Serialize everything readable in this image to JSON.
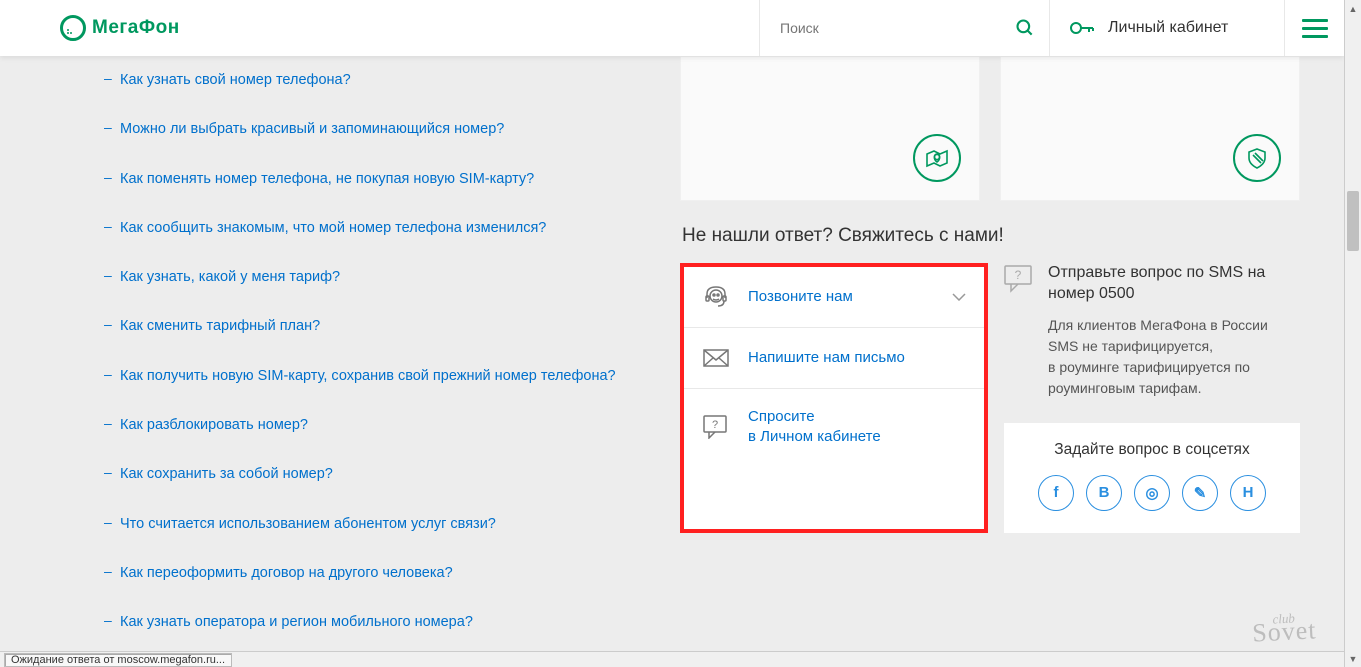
{
  "header": {
    "logo_text": "МегаФон",
    "search_placeholder": "Поиск",
    "cabinet_label": "Личный кабинет"
  },
  "faq": [
    "Как узнать свой номер телефона?",
    "Можно ли выбрать красивый и запоминающийся номер?",
    "Как поменять номер телефона, не покупая новую SIM-карту?",
    "Как сообщить знакомым, что мой номер телефона изменился?",
    "Как узнать, какой у меня тариф?",
    "Как сменить тарифный план?",
    "Как получить новую SIM-карту, сохранив свой прежний номер телефона?",
    "Как разблокировать номер?",
    "Как сохранить за собой номер?",
    "Что считается использованием абонентом услуг связи?",
    "Как переоформить договор на другого человека?",
    "Как узнать оператора и регион мобильного номера?"
  ],
  "contact_heading": "Не нашли ответ? Свяжитесь с нами!",
  "contact_items": {
    "call": "Позвоните нам",
    "write": "Напишите нам\nписьмо",
    "ask_line1": "Спросите",
    "ask_line2": "в Личном кабинете"
  },
  "sms": {
    "title": "Отправьте вопрос по SMS на номер 0500",
    "desc": "Для клиентов МегаФона в России SMS не тарифицируется,\nв роуминге тарифицируется по роуминговым тарифам."
  },
  "social": {
    "title": "Задайте вопрос в соцсетях",
    "items": [
      "f",
      "В",
      "◎",
      "✎",
      "Н"
    ]
  },
  "status_bar": "Ожидание ответа от moscow.megafon.ru...",
  "watermark": {
    "top": "club",
    "bottom": "Sovet"
  }
}
